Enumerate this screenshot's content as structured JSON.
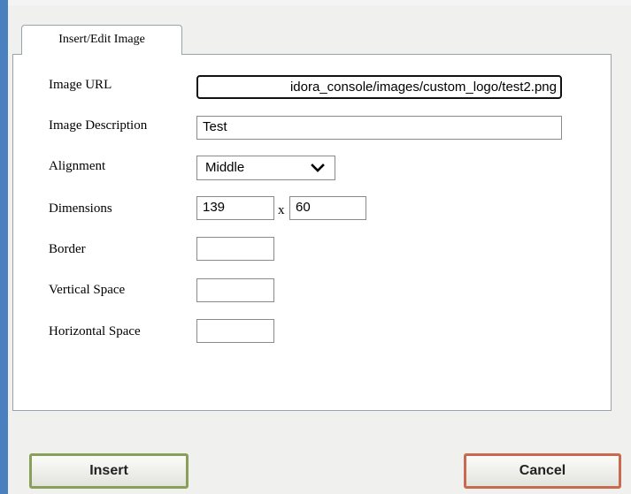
{
  "tab": {
    "label": "Insert/Edit Image"
  },
  "form": {
    "image_url": {
      "label": "Image URL",
      "value": "idora_console/images/custom_logo/test2.png"
    },
    "image_description": {
      "label": "Image Description",
      "value": "Test"
    },
    "alignment": {
      "label": "Alignment",
      "value": "Middle"
    },
    "dimensions": {
      "label": "Dimensions",
      "width": "139",
      "separator": "x",
      "height": "60"
    },
    "border": {
      "label": "Border",
      "value": ""
    },
    "vertical_space": {
      "label": "Vertical Space",
      "value": ""
    },
    "horizontal_space": {
      "label": "Horizontal Space",
      "value": ""
    }
  },
  "buttons": {
    "insert": "Insert",
    "cancel": "Cancel"
  },
  "colors": {
    "window_frame": "#4a7fc0",
    "insert_border": "#8aa05a",
    "cancel_border": "#c9694f"
  }
}
